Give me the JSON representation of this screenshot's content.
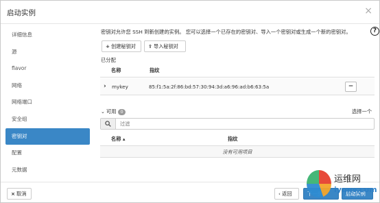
{
  "header": {
    "title": "启动实例",
    "close_glyph": "×"
  },
  "sidebar": {
    "items": [
      {
        "label": "详细信息"
      },
      {
        "label": "源"
      },
      {
        "label": "flavor"
      },
      {
        "label": "网络"
      },
      {
        "label": "网络端口"
      },
      {
        "label": "安全组"
      },
      {
        "label": "密钥对",
        "active": true
      },
      {
        "label": "配置"
      },
      {
        "label": "元数据"
      }
    ]
  },
  "main": {
    "description": "密钥对允许您 SSH 到新创建的实例。 您可以选择一个已存在的密钥对、导入一个密钥对或生成一个新的密钥对。",
    "create_button": "创建秘钥对",
    "import_button": "导入秘钥对",
    "allocated": {
      "label": "已分配",
      "headers": {
        "name": "名称",
        "fingerprint": "指纹"
      },
      "rows": [
        {
          "name": "mykey",
          "fingerprint": "85:f1:5a:2f:86:bd:57:30:94:3d:a6:96:ad:b6:63:5a"
        }
      ]
    },
    "available": {
      "label": "可用",
      "count": "0",
      "select_hint": "选择一个",
      "search_placeholder": "过滤",
      "headers": {
        "name": "名称",
        "fingerprint": "指纹"
      },
      "empty_text": "没有可用项目"
    }
  },
  "footer": {
    "cancel": "取消",
    "back": "‹ 返回",
    "next": "下一步 ›",
    "launch": "启动实例"
  },
  "watermark": {
    "site": "运维网",
    "domain": "iyunv.com"
  },
  "colors": {
    "accent": "#3a87c6",
    "border": "#cccccc"
  }
}
